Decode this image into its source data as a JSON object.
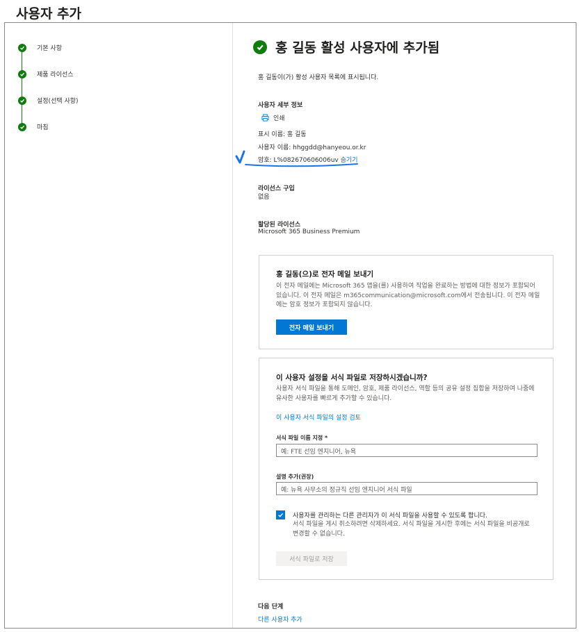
{
  "page_title": "사용자 추가",
  "steps": [
    {
      "label": "기본 사항"
    },
    {
      "label": "제품 라이선스"
    },
    {
      "label": "설정(선택 사항)"
    },
    {
      "label": "마침"
    }
  ],
  "headline": "홍 길동 활성 사용자에 추가됨",
  "subtitle": "홍 길동이(가) 활성 사용자 목록에 표시됩니다.",
  "details": {
    "heading": "사용자 세부 정보",
    "print_label": "인쇄",
    "display_name": "표시 이름: 홍 길동",
    "username": "사용자 이름: hhggdd@hanyeou.or.kr",
    "password": "암호: L%082670606006uv",
    "hide_link": "숨기기"
  },
  "license_purchase": {
    "heading": "라이선스 구입",
    "value": "없음"
  },
  "assigned_license": {
    "heading": "할당된 라이선스",
    "value": "Microsoft 365 Business Premium"
  },
  "email_card": {
    "title": "홍 길동(으)로 전자 메일 보내기",
    "body": "이 전자 메일에는 Microsoft 365 앱을(를) 사용하여 작업을 완료하는 방법에 대한 정보가 포함되어 있습니다. 이 전자 메일은 m365communication@microsoft.com에서 전송됩니다. 이 전자 메일에는 암호 정보가 포함되지 않습니다.",
    "button": "전자 메일 보내기"
  },
  "template_card": {
    "title": "이 사용자 설정을 서식 파일로 저장하시겠습니까?",
    "body": "사용자 서식 파일을 통해 도메인, 암호, 제품 라이선스, 역할 등의 공유 설정 집합을 저장하여 나중에 유사한 사용자를 빠르게 추가할 수 있습니다.",
    "review_link": "이 사용자 서식 파일의 설정 검토",
    "name_label": "서식 파일 이름 지정 *",
    "name_placeholder": "예: FTE 선임 엔지니어, 뉴욕",
    "desc_label": "설명 추가(권장)",
    "desc_placeholder": "예: 뉴욕 사무소의 정규직 선임 엔지니어 서식 파일",
    "checkbox_label": "사용자를 관리하는 다른 관리자가 이 서식 파일을 사용할 수 있도록 합니다.",
    "checkbox_hint": "서식 파일을 게시 취소하려면 삭제하세요. 서식 파일을 게시한 후에는 서식 파일을 비공개로 변경할 수 없습니다.",
    "save_button": "서식 파일로 저장"
  },
  "next_steps": {
    "heading": "다음 단계",
    "link": "다른 사용자 추가"
  },
  "colors": {
    "accent": "#0078d4",
    "success": "#107c10",
    "annotation": "#1a73e8"
  }
}
